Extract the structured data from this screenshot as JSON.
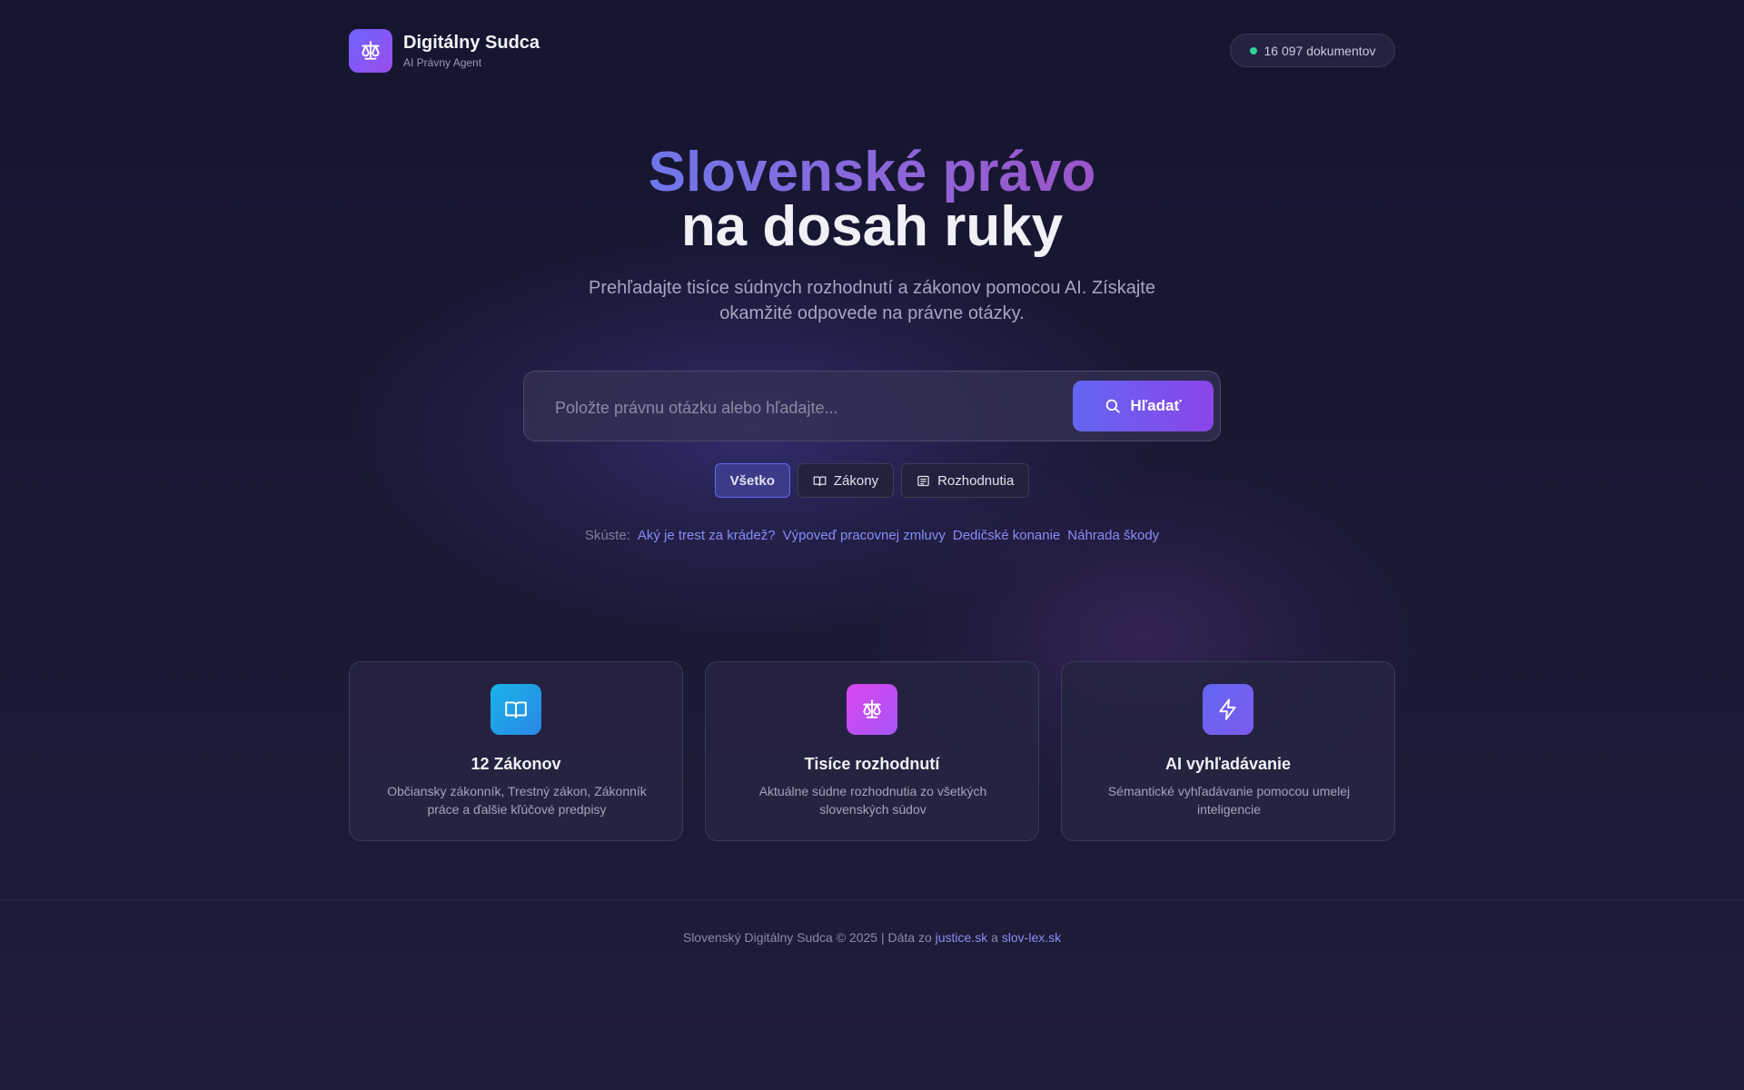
{
  "header": {
    "app_title": "Digitálny Sudca",
    "app_subtitle": "AI Právny Agent",
    "doc_count": "16 097 dokumentov"
  },
  "hero": {
    "line1": "Slovenské právo",
    "line2": "na dosah ruky",
    "subtitle": "Prehľadajte tisíce súdnych rozhodnutí a zákonov pomocou AI. Získajte okamžité odpovede na právne otázky."
  },
  "search": {
    "placeholder": "Položte právnu otázku alebo hľadajte...",
    "button_label": "Hľadať"
  },
  "filters": [
    {
      "label": "Všetko",
      "active": true
    },
    {
      "label": "Zákony",
      "icon": "book-icon"
    },
    {
      "label": "Rozhodnutia",
      "icon": "document-icon"
    }
  ],
  "suggestions": {
    "label": "Skúste:",
    "items": [
      "Aký je trest za krádež?",
      "Výpoveď pracovnej zmluvy",
      "Dedičské konanie",
      "Náhrada škody"
    ]
  },
  "cards": [
    {
      "title": "12 Zákonov",
      "description": "Občiansky zákonník, Trestný zákon, Zákonník práce a ďalšie kľúčové predpisy",
      "icon": "book-icon",
      "color": "#1ea8e0"
    },
    {
      "title": "Tisíce rozhodnutí",
      "description": "Aktuálne súdne rozhodnutia zo všetkých slovenských súdov",
      "icon": "scales-icon",
      "color": "#c247e8"
    },
    {
      "title": "AI vyhľadávanie",
      "description": "Sémantické vyhľadávanie pomocou umelej inteligencie",
      "icon": "lightning-icon",
      "color": "#6366f1"
    }
  ],
  "footer": {
    "text_before": "Slovenský Digitálny Sudca © 2025 | Dáta zo",
    "link1": "justice.sk",
    "conj": "a",
    "link2": "slov-lex.sk"
  },
  "colors": {
    "accent": "#6366f1",
    "accent2": "#8b45e8",
    "background": "#171630",
    "status_dot": "#34d399"
  }
}
